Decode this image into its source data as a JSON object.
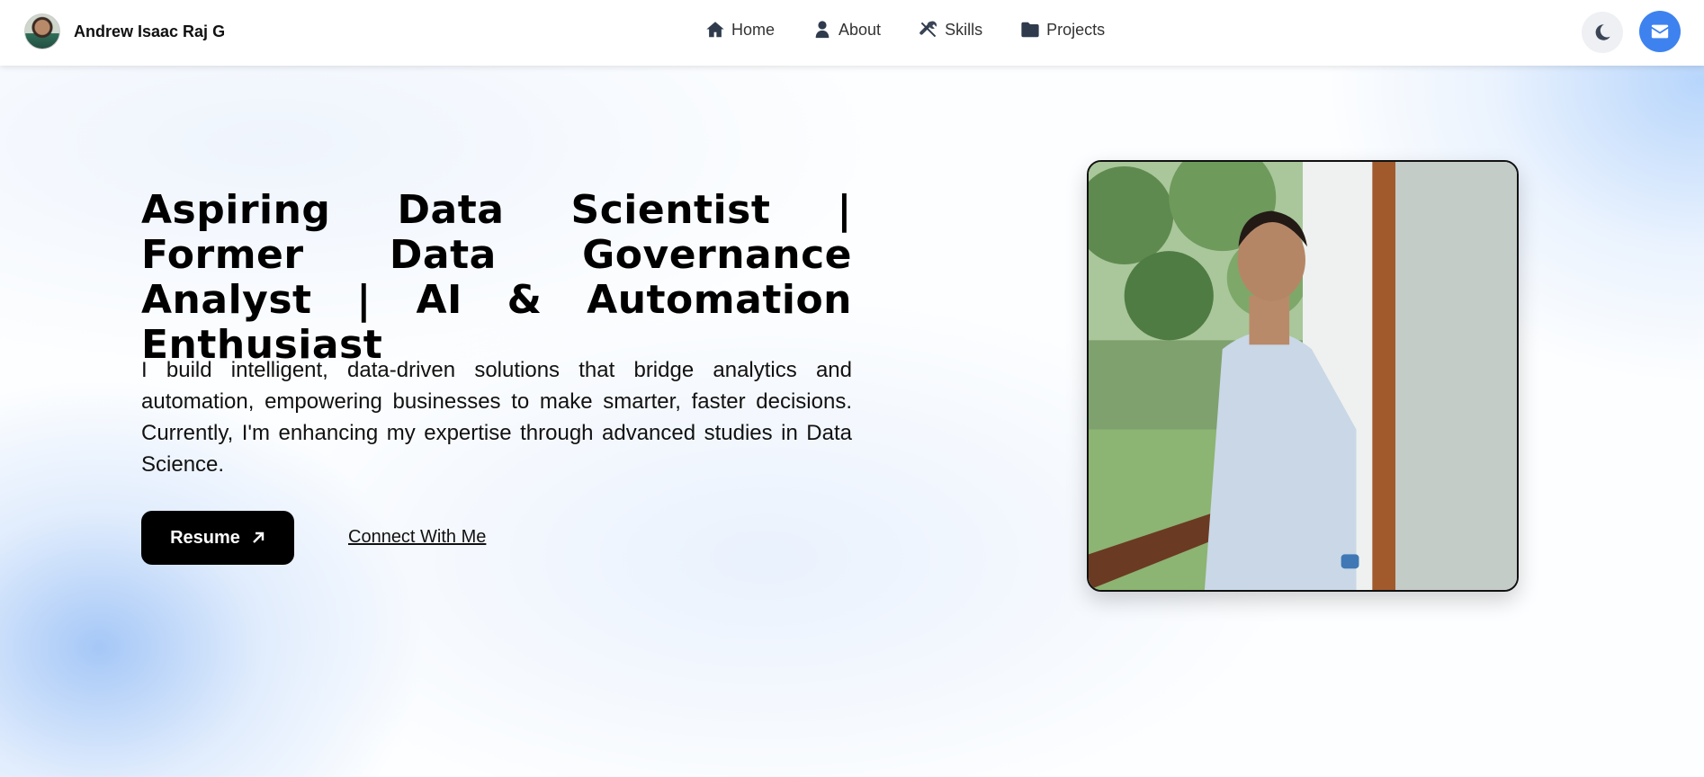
{
  "brand": {
    "name": "Andrew Isaac Raj G",
    "avatar_icon": "profile-avatar"
  },
  "nav": {
    "items": [
      {
        "label": "Home",
        "icon": "home-icon"
      },
      {
        "label": "About",
        "icon": "user-icon"
      },
      {
        "label": "Skills",
        "icon": "tools-icon"
      },
      {
        "label": "Projects",
        "icon": "folder-icon"
      }
    ],
    "theme_toggle_icon": "moon-icon",
    "contact_icon": "envelope-icon"
  },
  "hero": {
    "title": "Aspiring Data Scientist | Former Data Governance Analyst | AI & Automation Enthusiast",
    "description": "I build intelligent, data-driven solutions that bridge analytics and automation, empowering businesses to make smarter, faster decisions. Currently, I'm enhancing my expertise through advanced studies in Data Science.",
    "resume_label": "Resume",
    "connect_label": "Connect With Me"
  },
  "colors": {
    "accent": "#3d82ef",
    "primary_button": "#000000",
    "nav_icon": "#2f3b4d"
  }
}
